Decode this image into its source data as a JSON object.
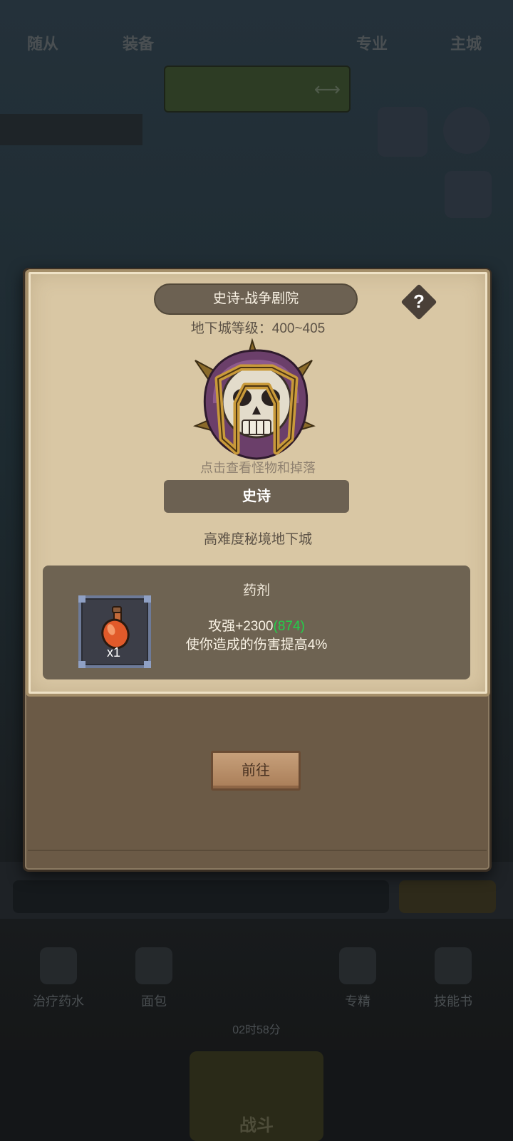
{
  "background": {
    "top_banner": "",
    "ticker": "",
    "shortcuts": [
      {
        "label": "治疗药水"
      },
      {
        "label": "面包"
      },
      {
        "label": "专精"
      },
      {
        "label": "技能书"
      }
    ],
    "timer": "02时58分",
    "chat_placeholder": "",
    "nav": [
      {
        "label": "随从"
      },
      {
        "label": "装备"
      },
      {
        "label": "战斗"
      },
      {
        "label": "专业"
      },
      {
        "label": "主城"
      }
    ]
  },
  "dungeon": {
    "title": "史诗-战争剧院",
    "help_label": "?",
    "level_text": "地下城等级：400~405",
    "hint": "点击查看怪物和掉落",
    "difficulty_label": "史诗",
    "description": "高难度秘境地下城",
    "reward": {
      "title": "药剂",
      "item_quantity": "x1",
      "stat_prefix": "攻强+2300",
      "stat_bonus": "(874)",
      "effect": "使你造成的伤害提高4%"
    },
    "go_label": "前往"
  },
  "colors": {
    "parchment": "#d9c7a4",
    "panel_dark": "#6e6352",
    "bonus_green": "#22d14a"
  }
}
